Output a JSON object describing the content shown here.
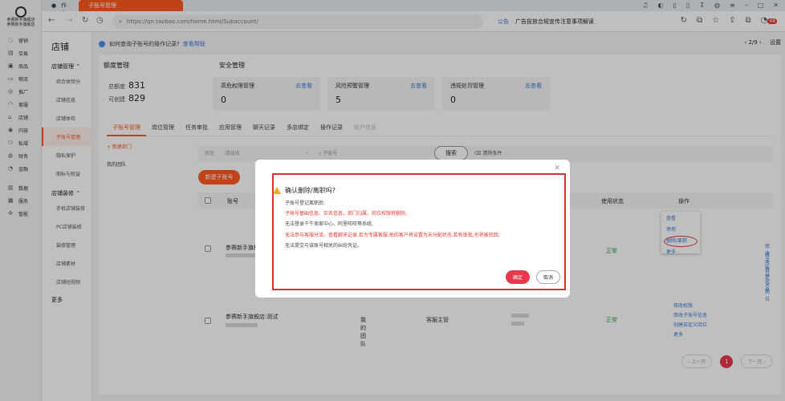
{
  "browser": {
    "tabs": [
      {
        "label": "工作台"
      },
      {
        "label": "子账号管理"
      }
    ],
    "url": "https://qn.taobao.com/home.html/Subaccount/",
    "notice_label": "公告",
    "notice_text": "广告投放合规宣传注意事项解读",
    "badge_count": "48"
  },
  "rail": {
    "store_name_1": "参赛新手旗舰店",
    "store_name_2": "参赛新手旗舰店",
    "items": [
      {
        "label": "营销"
      },
      {
        "label": "交易"
      },
      {
        "label": "商品"
      },
      {
        "label": "物流"
      },
      {
        "label": "推广"
      },
      {
        "label": "客服"
      },
      {
        "label": "店铺"
      },
      {
        "label": "内容"
      },
      {
        "label": "私域"
      },
      {
        "label": "财务"
      },
      {
        "label": "金融"
      },
      {
        "label": "数据"
      },
      {
        "label": "服务"
      },
      {
        "label": "智能"
      }
    ]
  },
  "subnav": {
    "title": "店铺",
    "group1": "店铺管理",
    "group1_items": [
      "综合体验分",
      "店铺信息",
      "店铺体检",
      "子账号管理",
      "隐私保护",
      "图标与权益"
    ],
    "group2": "店铺装修",
    "group2_items": [
      "手机店铺装修",
      "PC店铺装修",
      "装修管理",
      "店铺素材",
      "店铺短视频"
    ],
    "more": "更多"
  },
  "tip": {
    "text": "如何查询子账号的操作记录?",
    "link": "查看帮助",
    "pager": "‹ 2/9 ›",
    "setting": "设置"
  },
  "quota": {
    "title": "额度管理",
    "total_label": "总额度",
    "total_value": "831",
    "creatable_label": "可创建",
    "creatable_value": "829"
  },
  "security": {
    "title": "安全管理",
    "boxes": [
      {
        "name": "高危权限管理",
        "action": "去查看",
        "value": "0"
      },
      {
        "name": "风险预警管理",
        "action": "去查看",
        "value": "5"
      },
      {
        "name": "违规处罚管理",
        "action": "去查看",
        "value": "0"
      }
    ]
  },
  "tabs": [
    {
      "label": "子账号管理"
    },
    {
      "label": "岗位管理"
    },
    {
      "label": "任务审批"
    },
    {
      "label": "应用管理"
    },
    {
      "label": "聊天记录"
    },
    {
      "label": "多店绑定"
    },
    {
      "label": "操作记录"
    },
    {
      "label": "账户信息"
    }
  ],
  "left_tree": {
    "new_dept": "+ 新建部门",
    "team": "我的团队"
  },
  "filter": {
    "status_label": "状态",
    "status_placeholder": "请选择",
    "account_placeholder": "子账号",
    "search": "搜索",
    "clear": "清除条件"
  },
  "add_button": "新建子账号",
  "table": {
    "headers": [
      "账号",
      "使用状态",
      "操作"
    ],
    "rows": [
      {
        "account": "参赛新手旗舰店",
        "team": "",
        "role": "",
        "status": "正常",
        "ops": [
          "查看",
          "停用",
          "删除/离职",
          "修改子账号信息",
          "修改自定义岗位",
          "更多"
        ]
      },
      {
        "account": "参赛新手旗舰店:测试",
        "team": "我的团队",
        "role": "客服主管",
        "status": "正常",
        "ops": [
          "修改权限",
          "修改子账号信息",
          "创建自定义岗位",
          "更多"
        ]
      }
    ]
  },
  "pagination": {
    "prev": "‹ 上一页",
    "current": "1",
    "next": "下一页 ›"
  },
  "modal": {
    "title": "确认删除/离职吗?",
    "lines": [
      {
        "text": "子账号登记离职后:",
        "red": false
      },
      {
        "text": "子账号基础信息、实名信息、部门归属、岗位权限将删除;",
        "red": true
      },
      {
        "text": "无法登录千牛卖家中心、阿里旺旺等系统;",
        "red": false
      },
      {
        "text": "无法参与客服分流、查看聊天记录,若为专属客服,他的客户将设置为未分配状态,若有审批,也将被驳回;",
        "red": true
      },
      {
        "text": "无法提交与该账号相关的纠纷凭证。",
        "red": false
      }
    ],
    "ok": "确定",
    "cancel": "取消"
  },
  "colors": {
    "brand": "#ff5a1f",
    "danger": "#e53935",
    "link": "#3a7bd5",
    "ok_green": "#2aa54a"
  }
}
